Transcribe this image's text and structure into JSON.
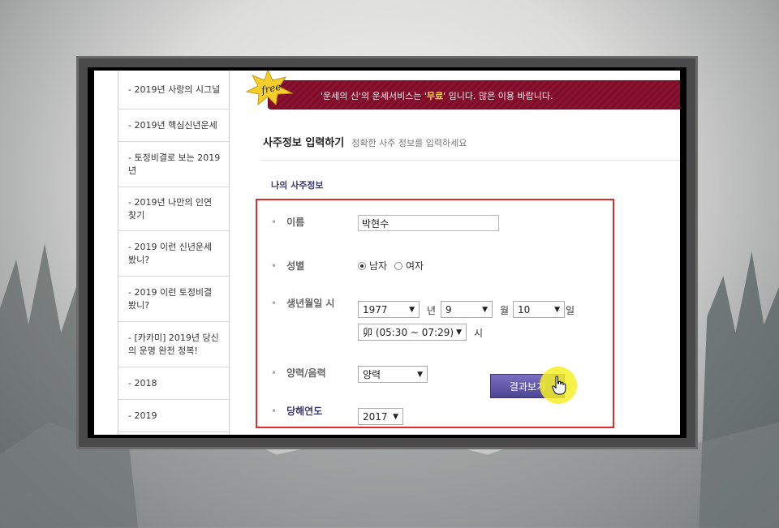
{
  "sidebar": {
    "items": [
      {
        "label": "- 2019년 사랑의 시그널"
      },
      {
        "label": "- 2019년 핵심신년운세"
      },
      {
        "label": "- 토정비결로 보는 2019년"
      },
      {
        "label": "- 2019년 나만의 인연 찾기"
      },
      {
        "label": "- 2019 이런 신년운세 봤니?"
      },
      {
        "label": "- 2019 이런 토정비결 봤니?"
      },
      {
        "label": "- [카카미] 2019년 당신의 운명 완전 정복!"
      },
      {
        "label": "- 2018"
      },
      {
        "label": "- 2019"
      }
    ]
  },
  "banner": {
    "badge": "free",
    "text_before": "'운세의 신'의 운세서비스는 '",
    "text_strong": "무료",
    "text_after": "' 입니다. 많은 이용 바랍니다."
  },
  "section": {
    "title": "사주정보 입력하기",
    "subtitle": "정확한 사주 정보를 입력하세요",
    "sub_title": "나의 사주정보"
  },
  "form": {
    "bullet": "•",
    "name_label": "이름",
    "name_value": "박현수",
    "gender_label": "성별",
    "gender_male": "남자",
    "gender_female": "여자",
    "birth_label": "생년월일 시",
    "year": "1977",
    "year_unit": "년",
    "month": "9",
    "month_unit": "월",
    "day": "10",
    "day_unit": "일",
    "hour": "卯 (05:30 ~ 07:29)",
    "hour_unit": "시",
    "calendar_label": "양력/음력",
    "calendar_value": "양력",
    "target_year_label": "당해연도",
    "target_year": "2017",
    "submit": "결과보기"
  },
  "colors": {
    "banner": "#8b1230",
    "highlight_box": "#e02b2b",
    "button": "#5a50a6",
    "cursor_halo": "#f5f028"
  }
}
